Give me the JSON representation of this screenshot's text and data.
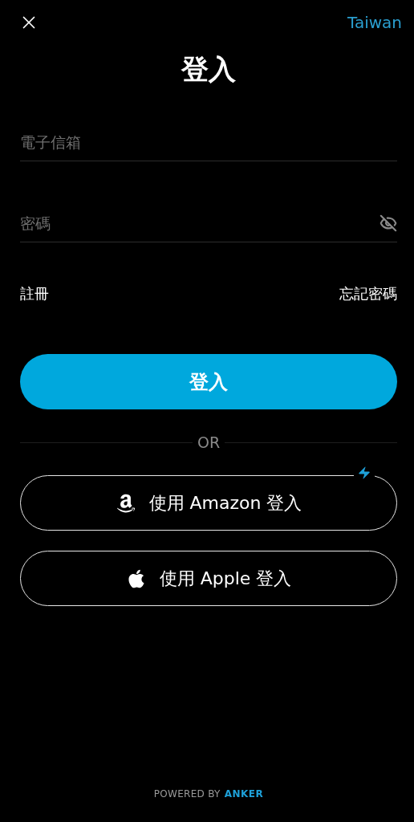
{
  "header": {
    "region": "Taiwan"
  },
  "title": "登入",
  "fields": [
    {
      "kind": "text",
      "placeholder": "電子信箱"
    },
    {
      "kind": "password",
      "placeholder": "密碼",
      "password_hidden": true
    }
  ],
  "links": {
    "register": "註冊",
    "forgot": "忘記密碼"
  },
  "login_button": "登入",
  "divider": "OR",
  "social_buttons": [
    {
      "kind": "amazon",
      "label": "使用 Amazon 登入",
      "featured": true
    },
    {
      "kind": "apple",
      "label": "使用 Apple 登入",
      "featured": false
    }
  ],
  "footer": {
    "prefix": "POWERED BY",
    "brand": "ANKER"
  }
}
